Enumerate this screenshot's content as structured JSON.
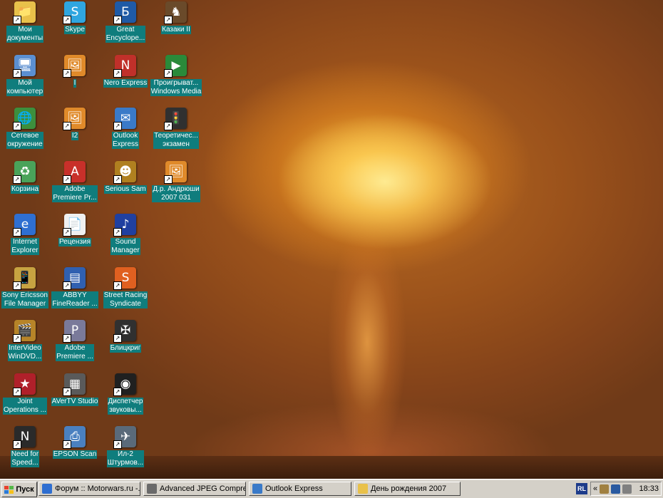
{
  "desktop": {
    "icons": [
      {
        "label": "Мои\nдокументы",
        "icon": "folder-icon",
        "color": "#e9c14a",
        "glyph": "📁"
      },
      {
        "label": "Мой\nкомпьютер",
        "icon": "computer-icon",
        "color": "#5b8fd1",
        "glyph": "🖥"
      },
      {
        "label": "Сетевое\nокружение",
        "icon": "network-icon",
        "color": "#3d8f3d",
        "glyph": "🌐"
      },
      {
        "label": "Корзина",
        "icon": "recycle-bin-icon",
        "color": "#4aa35a",
        "glyph": "♻"
      },
      {
        "label": "Internet\nExplorer",
        "icon": "internet-explorer-icon",
        "color": "#2f6fd1",
        "glyph": "e"
      },
      {
        "label": "Sony Ericsson\nFile Manager",
        "icon": "phone-icon",
        "color": "#c7a341",
        "glyph": "📱"
      },
      {
        "label": "InterVideo\nWinDVD...",
        "icon": "dvd-player-icon",
        "color": "#b78428",
        "glyph": "🎬"
      },
      {
        "label": "Joint\nOperations ...",
        "icon": "game-icon",
        "color": "#b0202a",
        "glyph": "★"
      },
      {
        "label": "Need for\nSpeed...",
        "icon": "racing-game-icon",
        "color": "#2a2a2a",
        "glyph": "N"
      },
      {
        "label": "Skype",
        "icon": "skype-icon",
        "color": "#2fa6e0",
        "glyph": "S"
      },
      {
        "label": "I",
        "icon": "jpeg-file-icon",
        "color": "#e08a2a",
        "glyph": "🖼"
      },
      {
        "label": "I2",
        "icon": "jpeg-file-icon",
        "color": "#e08a2a",
        "glyph": "🖼"
      },
      {
        "label": "Adobe\nPremiere Pr...",
        "icon": "pdf-file-icon",
        "color": "#c8302a",
        "glyph": "A"
      },
      {
        "label": "Рецензия",
        "icon": "document-icon",
        "color": "#f0f0f0",
        "glyph": "📄"
      },
      {
        "label": "ABBYY\nFineReader ...",
        "icon": "scanner-icon",
        "color": "#3060b0",
        "glyph": "▤"
      },
      {
        "label": "Adobe\nPremiere ...",
        "icon": "premiere-icon",
        "color": "#7a7a9a",
        "glyph": "P"
      },
      {
        "label": "AVerTV Studio",
        "icon": "remote-control-icon",
        "color": "#5a5a5a",
        "glyph": "▦"
      },
      {
        "label": "EPSON Scan",
        "icon": "epson-scan-icon",
        "color": "#4a80c0",
        "glyph": "⎙"
      },
      {
        "label": "Great\nEncyclope...",
        "icon": "encyclopedia-icon",
        "color": "#1f5aa6",
        "glyph": "Б"
      },
      {
        "label": "Nero Express",
        "icon": "nero-icon",
        "color": "#c0302a",
        "glyph": "N"
      },
      {
        "label": "Outlook\nExpress",
        "icon": "outlook-express-icon",
        "color": "#3a7ac8",
        "glyph": "✉"
      },
      {
        "label": "Serious Sam",
        "icon": "serious-sam-icon",
        "color": "#b08020",
        "glyph": "☻"
      },
      {
        "label": "Sound\nManager",
        "icon": "sound-manager-icon",
        "color": "#2040a0",
        "glyph": "♪"
      },
      {
        "label": "Street Racing\nSyndicate",
        "icon": "street-racing-icon",
        "color": "#e06020",
        "glyph": "S"
      },
      {
        "label": "Блицкриг",
        "icon": "blitzkrieg-icon",
        "color": "#303030",
        "glyph": "✠"
      },
      {
        "label": "Диспетчер\nзвуковы...",
        "icon": "sound-dispatcher-icon",
        "color": "#202020",
        "glyph": "◉"
      },
      {
        "label": "Ил-2\nШтурмов...",
        "icon": "plane-icon",
        "color": "#5a6a7a",
        "glyph": "✈"
      },
      {
        "label": "Казаки II",
        "icon": "cossacks-icon",
        "color": "#6a4a2a",
        "glyph": "♞"
      },
      {
        "label": "Проигрыват...\nWindows Media",
        "icon": "windows-media-player-icon",
        "color": "#2a8a3a",
        "glyph": "▶"
      },
      {
        "label": "Теоретичес...\nэкзамен",
        "icon": "traffic-light-icon",
        "color": "#303030",
        "glyph": "🚦"
      },
      {
        "label": "Д.р. Андрюши\n2007 031",
        "icon": "jpeg-file-icon",
        "color": "#e08a2a",
        "glyph": "🖼"
      }
    ]
  },
  "taskbar": {
    "start_label": "Пуск",
    "tasks": [
      {
        "label": "Форум :: Motorwars.ru -...",
        "icon": "browser-icon",
        "color": "#2f6fd1"
      },
      {
        "label": "Advanced JPEG Compres...",
        "icon": "jpeg-compressor-icon",
        "color": "#6a6a6a"
      },
      {
        "label": "Outlook Express",
        "icon": "outlook-express-icon",
        "color": "#3a7ac8"
      },
      {
        "label": "День рождения 2007",
        "icon": "folder-icon",
        "color": "#e9c14a"
      }
    ],
    "tray": {
      "language": "RL",
      "chevron": "«",
      "time": "18:33"
    }
  }
}
